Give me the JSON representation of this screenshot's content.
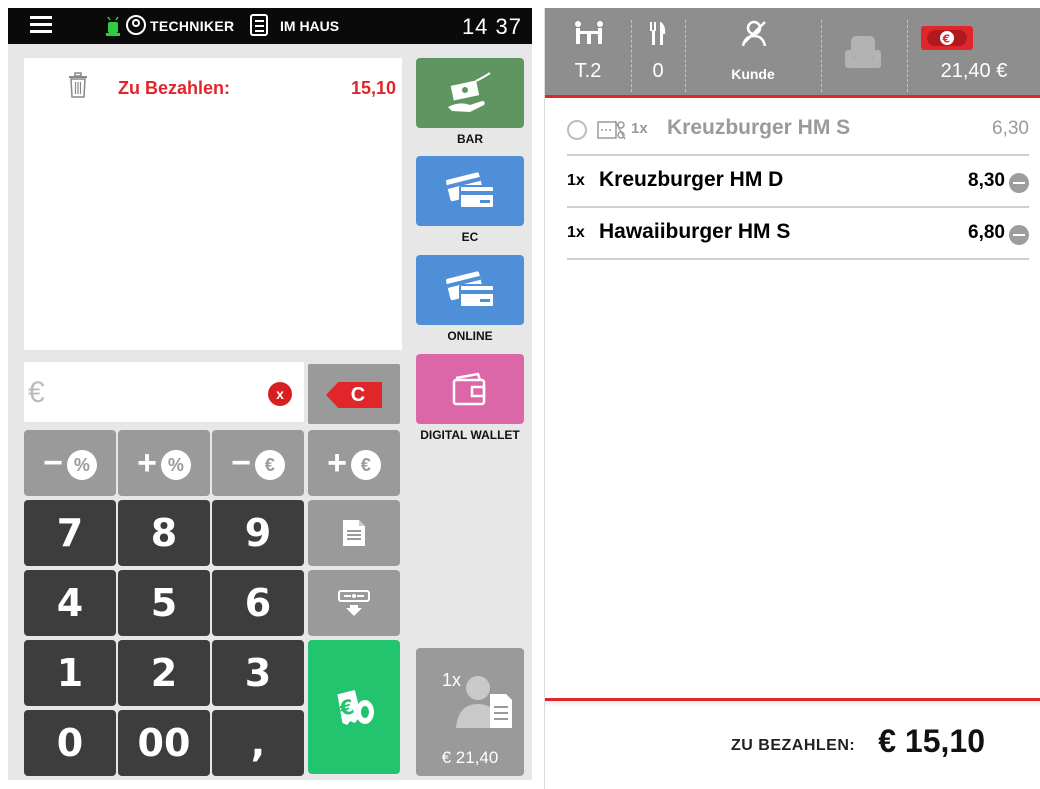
{
  "topbar": {
    "user": "TECHNIKER",
    "mode": "IM HAUS",
    "time": "14 37"
  },
  "summary": {
    "label": "Zu Bezahlen:",
    "value": "15,10"
  },
  "payments": [
    {
      "label": "BAR"
    },
    {
      "label": "EC"
    },
    {
      "label": "ONLINE"
    },
    {
      "label": "DIGITAL WALLET"
    }
  ],
  "amount_input": {
    "placeholder": "€",
    "clear_symbol": "x",
    "c_label": "C"
  },
  "function_keys": [
    {
      "sign": "−",
      "sym": "%"
    },
    {
      "sign": "+",
      "sym": "%"
    },
    {
      "sign": "−",
      "sym": "€"
    },
    {
      "sign": "+",
      "sym": "€"
    }
  ],
  "keypad": {
    "k7": "7",
    "k8": "8",
    "k9": "9",
    "k4": "4",
    "k5": "5",
    "k6": "6",
    "k1": "1",
    "k2": "2",
    "k3": "3",
    "k0": "0",
    "k00": "00",
    "kcomma": ","
  },
  "customer_button": {
    "qty": "1x",
    "total": "€ 21,40"
  },
  "order_header": {
    "table": "T.2",
    "guests": "0",
    "customer": "Kunde",
    "total": "21,40 €"
  },
  "order_items": [
    {
      "qty": "1x",
      "name": "Kreuzburger HM S",
      "price": "6,30",
      "state": "split"
    },
    {
      "qty": "1x",
      "name": "Kreuzburger HM D",
      "price": "8,30",
      "state": "open"
    },
    {
      "qty": "1x",
      "name": "Hawaiiburger HM S",
      "price": "6,80",
      "state": "open"
    }
  ],
  "footer": {
    "label": "ZU BEZAHLEN:",
    "amount": "€ 15,10"
  },
  "colors": {
    "accent_red": "#e0262a",
    "cash_green": "#5e9560",
    "card_blue": "#4f8fd8",
    "wallet_pink": "#db66a8",
    "pay_green": "#22c46d"
  }
}
